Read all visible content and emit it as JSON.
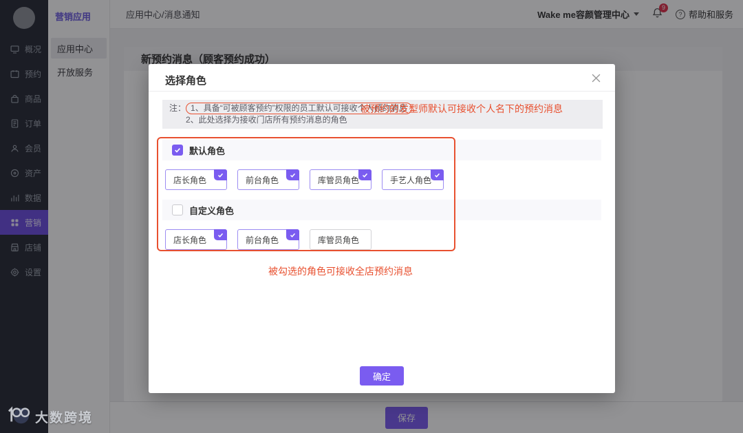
{
  "sidebar": {
    "items": [
      {
        "label": "概况",
        "icon": "overview-icon"
      },
      {
        "label": "预约",
        "icon": "booking-icon"
      },
      {
        "label": "商品",
        "icon": "goods-icon"
      },
      {
        "label": "订单",
        "icon": "orders-icon"
      },
      {
        "label": "会员",
        "icon": "members-icon"
      },
      {
        "label": "资产",
        "icon": "assets-icon"
      },
      {
        "label": "数据",
        "icon": "data-icon"
      },
      {
        "label": "营销",
        "icon": "marketing-icon",
        "active": true
      },
      {
        "label": "店铺",
        "icon": "shop-icon"
      },
      {
        "label": "设置",
        "icon": "settings-icon"
      }
    ]
  },
  "subsidebar": {
    "title": "营销应用",
    "items": [
      {
        "label": "应用中心",
        "active": true
      },
      {
        "label": "开放服务",
        "active": false
      }
    ]
  },
  "topbar": {
    "breadcrumb": "应用中心/消息通知",
    "workspace": "Wake me容颜管理中心",
    "notification_badge": "9",
    "help": "帮助和服务"
  },
  "content": {
    "card_title": "新预约消息（顾客预约成功）",
    "save_label": "保存"
  },
  "modal": {
    "title": "选择角色",
    "note_prefix": "注：",
    "note_line1": "1、具备“可被顾客预约”权限的员工默认可接收个人预约消息",
    "note_line2": "2、此处选择为接收门店所有预约消息的角色",
    "annotation_top": "被预约的发型师默认可接收个人名下的预约消息",
    "annotation_bottom": "被勾选的角色可接收全店预约消息",
    "confirm_label": "确定",
    "default_group": {
      "label": "默认角色",
      "checked": true,
      "roles": [
        {
          "label": "店长角色",
          "checked": true
        },
        {
          "label": "前台角色",
          "checked": true
        },
        {
          "label": "库管员角色",
          "checked": true
        },
        {
          "label": "手艺人角色",
          "checked": true
        }
      ]
    },
    "custom_group": {
      "label": "自定义角色",
      "checked": false,
      "roles": [
        {
          "label": "店长角色",
          "checked": true
        },
        {
          "label": "前台角色",
          "checked": true
        },
        {
          "label": "库管员角色",
          "checked": false
        }
      ]
    }
  },
  "watermark": {
    "text": "大数跨境"
  },
  "colors": {
    "accent_purple": "#7a5cf0",
    "sidebar_active_purple": "#6c4ee0",
    "annotation_red": "#e8502f",
    "badge_red": "#e0314b",
    "note_background": "#ededf0",
    "band_background": "#f8f8fb"
  }
}
